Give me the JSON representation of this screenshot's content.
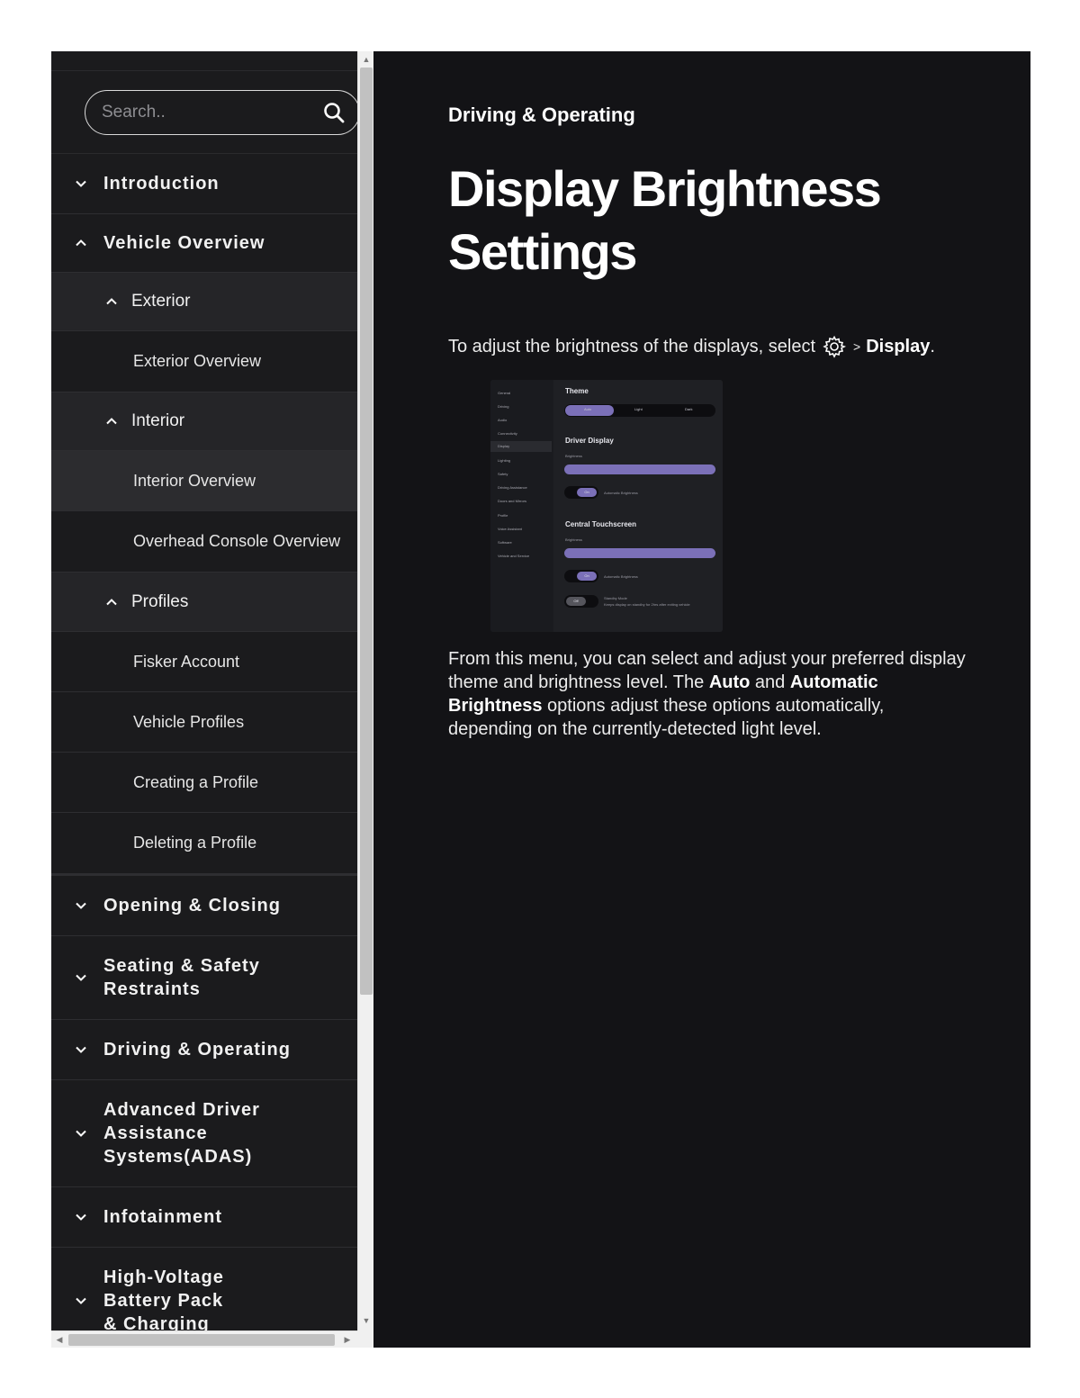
{
  "sidebar": {
    "search": {
      "placeholder": "Search.."
    },
    "items": [
      {
        "label": "Introduction",
        "level": 1,
        "expanded": false
      },
      {
        "label": "Vehicle Overview",
        "level": 1,
        "expanded": true
      },
      {
        "label": "Exterior",
        "level": 2,
        "expanded": true
      },
      {
        "label": "Exterior Overview",
        "level": 3
      },
      {
        "label": "Interior",
        "level": 2,
        "expanded": true
      },
      {
        "label": "Interior Overview",
        "level": 3,
        "active": true
      },
      {
        "label": "Overhead Console Overview",
        "level": 3
      },
      {
        "label": "Profiles",
        "level": 2,
        "expanded": true
      },
      {
        "label": "Fisker Account",
        "level": 3
      },
      {
        "label": "Vehicle Profiles",
        "level": 3
      },
      {
        "label": "Creating a Profile",
        "level": 3
      },
      {
        "label": "Deleting a Profile",
        "level": 3
      },
      {
        "label": "Opening & Closing",
        "level": 1,
        "expanded": false
      },
      {
        "label": "Seating & Safety Restraints",
        "level": 1,
        "expanded": false
      },
      {
        "label": "Driving & Operating",
        "level": 1,
        "expanded": false
      },
      {
        "label": "Advanced Driver Assistance Systems(ADAS)",
        "level": 1,
        "expanded": false
      },
      {
        "label": "Infotainment",
        "level": 1,
        "expanded": false
      },
      {
        "label": "High-Voltage Battery Pack & Charging",
        "level": 1,
        "expanded": false
      }
    ]
  },
  "main": {
    "breadcrumb": "Driving & Operating",
    "title": "Display Brightness Settings",
    "instruction": {
      "before": "To adjust the brightness of the displays, select",
      "separator": ">",
      "target": "Display",
      "after": "."
    },
    "figure": {
      "menu": [
        "General",
        "Driving",
        "Audio",
        "Connectivity",
        "Display",
        "Lighting",
        "Safety",
        "Driving Assistance",
        "Doors and Mirrors",
        "Profile",
        "Voice Assistant",
        "Software",
        "Vehicle and Service"
      ],
      "selected_menu": "Display",
      "theme_heading": "Theme",
      "theme_options": [
        "Auto",
        "Light",
        "Dark"
      ],
      "theme_selected": "Auto",
      "driver_display_heading": "Driver Display",
      "brightness_label": "Brightness",
      "auto_brightness_label": "Automatic Brightness",
      "on_label": "On",
      "central_heading": "Central Touchscreen",
      "central_brightness_label": "Brightness",
      "central_on_label": "On",
      "central_auto_brightness_label": "Automatic Brightness",
      "standby_label": "Standby Mode",
      "standby_desc": "Keeps display on standby for 2hrs after exiting vehicle",
      "off_label": "Off"
    },
    "description": {
      "part1": "From this menu, you can select and adjust your preferred display theme and brightness level. The ",
      "bold1": "Auto",
      "part2": " and ",
      "bold2": "Automatic Brightness",
      "part3": " options adjust these options automatically, depending on the currently-detected light level."
    }
  },
  "colors": {
    "sidebar_bg": "#1b1b1d",
    "main_bg": "#131316",
    "accent": "#7b70b8"
  }
}
